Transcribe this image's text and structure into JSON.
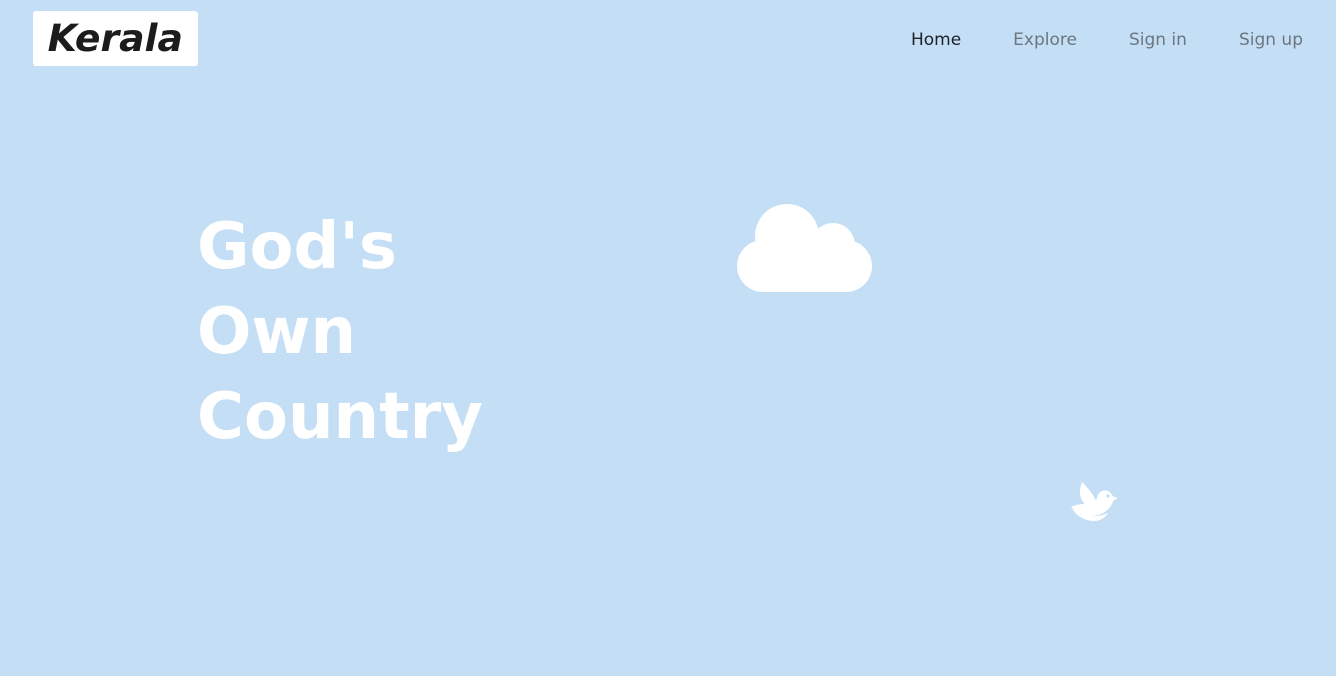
{
  "colors": {
    "background": "#c4def5",
    "logo_bg": "#ffffff",
    "logo_text": "#1c1c1c",
    "nav_active": "#1f2125",
    "nav_inactive": "#6b7680",
    "hero_text": "#ffffff",
    "decorations": "#ffffff"
  },
  "logo": {
    "text": "Kerala"
  },
  "nav": {
    "items": [
      {
        "label": "Home",
        "active": true
      },
      {
        "label": "Explore",
        "active": false
      },
      {
        "label": "Sign in",
        "active": false
      },
      {
        "label": "Sign up",
        "active": false
      }
    ]
  },
  "hero": {
    "lines": [
      "God's",
      "Own",
      "Country"
    ]
  },
  "decorations": {
    "cloud_icon": "cloud-icon",
    "bird_icon": "bird-icon"
  }
}
